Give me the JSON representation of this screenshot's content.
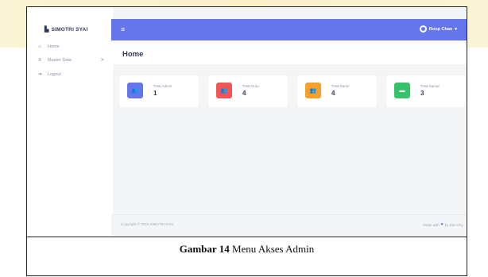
{
  "brand": {
    "name": "SIMOTRI SYAI",
    "icon": "school-icon"
  },
  "sidebar": {
    "items": [
      {
        "label": "Home",
        "icon": "home-icon"
      },
      {
        "label": "Master Data",
        "icon": "list-icon",
        "caret": ">"
      },
      {
        "label": "Logout",
        "icon": "logout-icon"
      }
    ]
  },
  "topbar": {
    "menu_icon": "≡",
    "user_name": "Roop Chan",
    "user_caret": "▾",
    "accent": "#6576ec"
  },
  "page": {
    "title": "Home"
  },
  "cards": [
    {
      "label": "Total Admin",
      "value": "1",
      "icon": "users-icon",
      "color": "#6576ec"
    },
    {
      "label": "Total Guru",
      "value": "4",
      "icon": "teachers-icon",
      "color": "#f25555"
    },
    {
      "label": "Total Santri",
      "value": "4",
      "icon": "students-icon",
      "color": "#f7a12b"
    },
    {
      "label": "Total Kamar",
      "value": "3",
      "icon": "bed-icon",
      "color": "#36c16b"
    }
  ],
  "footer": {
    "copyright": "Copyright © 2022 SIMOTRI SYAI",
    "made_with_prefix": "Made with",
    "made_with_suffix": "by Dito Izky"
  },
  "caption": {
    "label": "Gambar 14",
    "text": " Menu Akses Admin"
  }
}
